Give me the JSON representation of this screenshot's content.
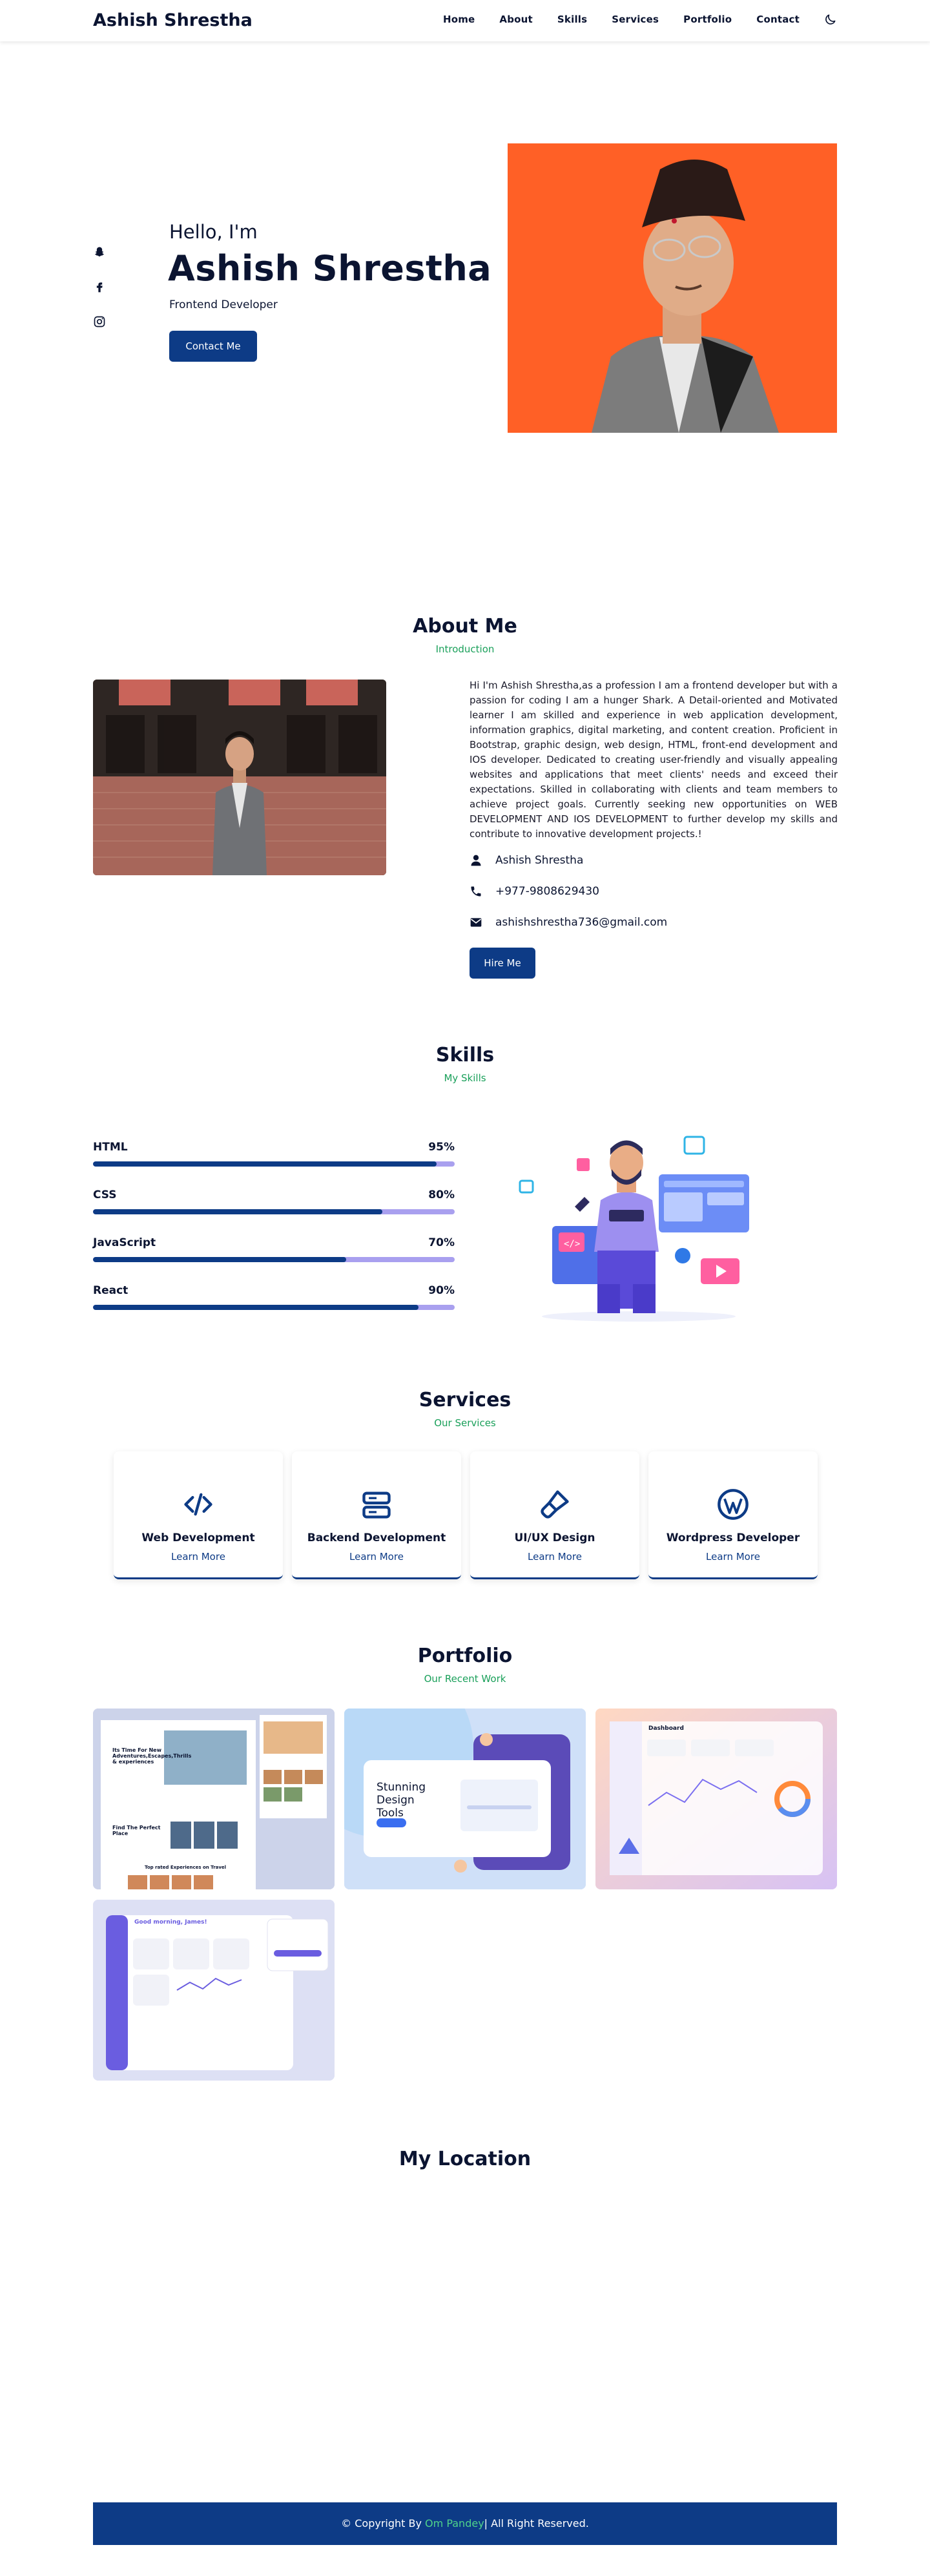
{
  "nav": {
    "brand": "Ashish Shrestha",
    "links": [
      "Home",
      "About",
      "Skills",
      "Services",
      "Portfolio",
      "Contact"
    ],
    "theme_icon": "moon-icon"
  },
  "hero": {
    "greeting": "Hello, I'm",
    "name": "Ashish Shrestha",
    "role": "Frontend Developer",
    "cta": "Contact Me",
    "socials": [
      "snapchat-icon",
      "facebook-icon",
      "instagram-icon"
    ]
  },
  "about": {
    "title": "About Me",
    "subtitle": "Introduction",
    "paragraph": "Hi I'm Ashish Shrestha,as a profession I am a frontend developer but with a passion for coding I am a hunger Shark. A Detail-oriented and Motivated learner I am skilled and experience in web application development, information graphics, digital marketing, and content creation. Proficient in Bootstrap, graphic design, web design, HTML, front-end development and IOS developer. Dedicated to creating user-friendly and visually appealing websites and applications that meet clients' needs and exceed their expectations. Skilled in collaborating with clients and team members to achieve project goals. Currently seeking new opportunities on WEB DEVELOPMENT AND IOS DEVELOPMENT to further develop my skills and contribute to innovative development projects.!",
    "name": "Ashish Shrestha",
    "phone": "+977-9808629430",
    "email": "ashishshrestha736@gmail.com",
    "cta": "Hire Me"
  },
  "skills": {
    "title": "Skills",
    "subtitle": "My Skills",
    "items": [
      {
        "name": "HTML",
        "percent_label": "95%",
        "level": 0.95
      },
      {
        "name": "CSS",
        "percent_label": "80%",
        "level": 0.8
      },
      {
        "name": "JavaScript",
        "percent_label": "70%",
        "level": 0.7
      },
      {
        "name": "React",
        "percent_label": "90%",
        "level": 0.9
      }
    ]
  },
  "services": {
    "title": "Services",
    "subtitle": "Our Services",
    "items": [
      {
        "title": "Web Development",
        "link": "Learn More",
        "icon": "code-icon"
      },
      {
        "title": "Backend Development",
        "link": "Learn More",
        "icon": "server-icon"
      },
      {
        "title": "UI/UX Design",
        "link": "Learn More",
        "icon": "paint-brush-icon"
      },
      {
        "title": "Wordpress Developer",
        "link": "Learn More",
        "icon": "wordpress-icon"
      }
    ]
  },
  "portfolio": {
    "title": "Portfolio",
    "subtitle": "Our Recent Work",
    "items": [
      {
        "heading": "Its Time For New Adventures,Escapes,Thrills & experiences",
        "sub": "Find The Perfect Place",
        "caption": "Top rated Experiences on Travel"
      },
      {
        "heading": "Stunning Design Tools"
      },
      {
        "heading": "Dashboard"
      },
      {
        "heading": "Good morning, James!"
      }
    ]
  },
  "location": {
    "title": "My Location"
  },
  "footer": {
    "prefix": "© Copyright By ",
    "author": "Om Pandey",
    "suffix": "| All Right Reserved."
  },
  "colors": {
    "navy": "#0d3b86",
    "green": "#1aa05a",
    "lavender": "#a9a0ef",
    "hero_bg": "#ff5b23"
  }
}
